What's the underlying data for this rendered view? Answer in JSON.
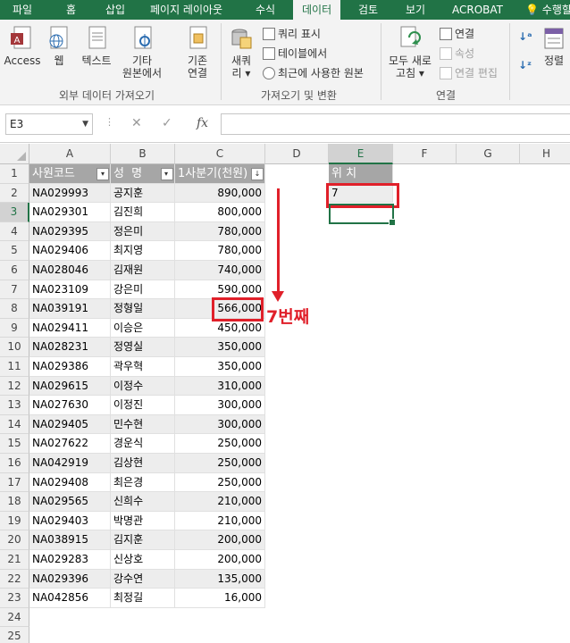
{
  "ribbon_tabs": [
    "파일",
    "홈",
    "삽입",
    "페이지 레이아웃",
    "수식",
    "데이터",
    "검토",
    "보기",
    "ACROBAT",
    "수행할"
  ],
  "active_tab": "데이터",
  "ribbon": {
    "access": "Access",
    "web": "웹",
    "text": "텍스트",
    "other_sources_1": "기타",
    "other_sources_2": "원본에서",
    "existing_1": "기존",
    "existing_2": "연결",
    "group_external": "외부 데이터 가져오기",
    "new_query_1": "새쿼",
    "new_query_2": "리 ▾",
    "show_queries": "쿼리 표시",
    "from_table": "테이블에서",
    "recent_sources": "최근에 사용한 원본",
    "group_transform": "가져오기 및 변환",
    "refresh_all_1": "모두 새로",
    "refresh_all_2": "고침 ▾",
    "connections": "연결",
    "properties": "속성",
    "edit_links": "연결 편집",
    "group_connections": "연결",
    "sort": "정렬"
  },
  "formula_bar": {
    "name_box": "E3",
    "formula": "",
    "fx": "fx"
  },
  "columns": [
    "A",
    "B",
    "C",
    "D",
    "E",
    "F",
    "G",
    "H"
  ],
  "rows": [
    "1",
    "2",
    "3",
    "4",
    "5",
    "6",
    "7",
    "8",
    "9",
    "10",
    "11",
    "12",
    "13",
    "14",
    "15",
    "16",
    "17",
    "18",
    "19",
    "20",
    "21",
    "22",
    "23",
    "24",
    "25"
  ],
  "table": {
    "headers": [
      "사원코드",
      "성 명",
      "1사분기(천원)"
    ],
    "records": [
      [
        "NA029993",
        "공지훈",
        "890,000"
      ],
      [
        "NA029301",
        "김진희",
        "800,000"
      ],
      [
        "NA029395",
        "정은미",
        "780,000"
      ],
      [
        "NA029406",
        "최지영",
        "780,000"
      ],
      [
        "NA028046",
        "김재원",
        "740,000"
      ],
      [
        "NA023109",
        "강은미",
        "590,000"
      ],
      [
        "NA039191",
        "정형일",
        "566,000"
      ],
      [
        "NA029411",
        "이승은",
        "450,000"
      ],
      [
        "NA028231",
        "정영실",
        "350,000"
      ],
      [
        "NA029386",
        "곽우혁",
        "350,000"
      ],
      [
        "NA029615",
        "이정수",
        "310,000"
      ],
      [
        "NA027630",
        "이정진",
        "300,000"
      ],
      [
        "NA029405",
        "민수현",
        "300,000"
      ],
      [
        "NA027622",
        "경운식",
        "250,000"
      ],
      [
        "NA042919",
        "김상현",
        "250,000"
      ],
      [
        "NA029408",
        "최은경",
        "250,000"
      ],
      [
        "NA029565",
        "신희수",
        "210,000"
      ],
      [
        "NA029403",
        "박명관",
        "210,000"
      ],
      [
        "NA038915",
        "김지훈",
        "200,000"
      ],
      [
        "NA029283",
        "신상호",
        "200,000"
      ],
      [
        "NA029396",
        "강수연",
        "135,000"
      ],
      [
        "NA042856",
        "최정길",
        "16,000"
      ]
    ]
  },
  "position_header": "위 치",
  "position_value": "7",
  "annotation": "7번째",
  "colors": {
    "accent": "#217346",
    "highlight": "#e0202a",
    "header_fill": "#a6a6a6"
  }
}
